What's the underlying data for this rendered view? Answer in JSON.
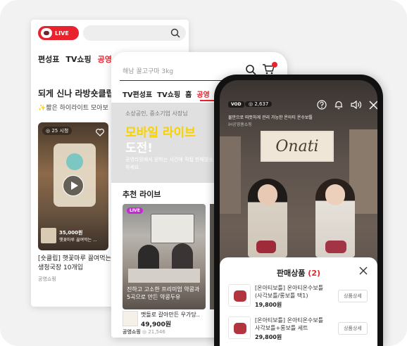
{
  "screen_back": {
    "live_label": "LIVE",
    "tabs": [
      "편성표",
      "TV쇼핑",
      "공영"
    ],
    "active_tab": 2,
    "section_title": "되게 신나 라방숏클립",
    "section_sub": "✨짧은 하이라이트 모아보",
    "card": {
      "views": "25 시청",
      "overlay_price": "35,000원",
      "overlay_desc": "햇꽃마루 끓여먹는 ..."
    },
    "product_title": "[숏클립] 햇꽃마루 끓여먹는 생청국장 10개입",
    "product_seller": "공영쇼핑"
  },
  "screen_mid": {
    "search_placeholder": "해남 꿀고구마 3kg",
    "tabs": [
      "TV편성표",
      "TV쇼핑",
      "홈",
      "공영"
    ],
    "active_tab": 3,
    "banner": {
      "small": "소상공인, 중소기업 사장님",
      "line1": "모바일 라이브",
      "line2": "도전!",
      "desc": "공영라방에서 원하는 시간에 직접 판매방송하세요."
    },
    "rec_title": "추천 라이브",
    "video_card": {
      "live_label": "LIVE",
      "caption": "진하고 고소한 프리미엄 약콩과 5곡으로 만든 약콩두유"
    },
    "item": {
      "title": "맷돌로 갈아만든 우가당..",
      "price": "49,900원",
      "seller": "공영쇼핑",
      "views": "21,546"
    }
  },
  "screen_front": {
    "badge": "VOD",
    "viewers": "2,637",
    "stream_title": "물만으로 따뜻하게 관리 가능한 온아티 온수보틀",
    "stream_seller": "iH공영홈쇼핑",
    "brand": "Onati",
    "panel": {
      "title": "판매상품",
      "count": "(2)",
      "products": [
        {
          "name": "[온아티보틀] 온아티온수보틀 (사각보틀/롱보틀 택1)",
          "price": "19,800원",
          "button": "상품상세"
        },
        {
          "name": "[온아티보틀] 온아티온수보틀 사각보틀+롱보틀 세트",
          "price": "29,800원",
          "button": "상품상세"
        }
      ]
    }
  },
  "colors": {
    "accent": "#e8232d",
    "banner_yellow": "#f7d200",
    "live_purple": "#c22bd2"
  }
}
